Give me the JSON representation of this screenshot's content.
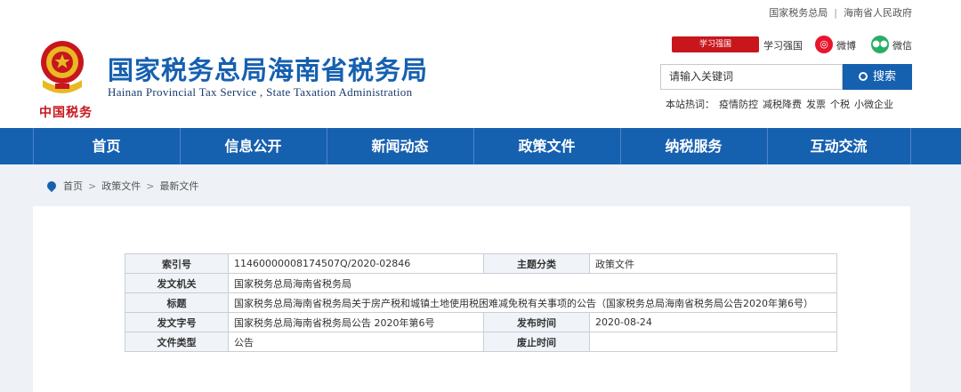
{
  "topbar": {
    "link1": "国家税务总局",
    "separator": "|",
    "link2": "海南省人民政府"
  },
  "header": {
    "title_cn": "国家税务总局海南省税务局",
    "title_en": "Hainan Provincial Tax Service , State Taxation Administration",
    "brand": "中国税务",
    "xxqg_badge": "学习强国",
    "xxqg_label": "学习强国",
    "weibo_label": "微博",
    "weixin_label": "微信",
    "search": {
      "placeholder": "请输入关键词",
      "button_label": "搜索"
    },
    "hot": {
      "label": "本站热词：",
      "items": [
        "疫情防控",
        "减税降费",
        "发票",
        "个税",
        "小微企业"
      ]
    }
  },
  "nav": {
    "items": [
      "首页",
      "信息公开",
      "新闻动态",
      "政策文件",
      "纳税服务",
      "互动交流"
    ]
  },
  "breadcrumb": {
    "items": [
      "首页",
      "政策文件",
      "最新文件"
    ],
    "separator": ">"
  },
  "info_table": {
    "index_label": "索引号",
    "index_value": "11460000008174507Q/2020-02846",
    "topic_label": "主题分类",
    "topic_value": "政策文件",
    "issuer_label": "发文机关",
    "issuer_value": "国家税务总局海南省税务局",
    "title_label": "标题",
    "title_value": "国家税务总局海南省税务局关于房产税和城镇土地使用税困难减免税有关事项的公告（国家税务总局海南省税务局公告2020年第6号）",
    "docno_label": "发文字号",
    "docno_value": "国家税务总局海南省税务局公告 2020年第6号",
    "pubdate_label": "发布时间",
    "pubdate_value": "2020-08-24",
    "filetype_label": "文件类型",
    "filetype_value": "公告",
    "abolish_label": "废止时间",
    "abolish_value": ""
  }
}
